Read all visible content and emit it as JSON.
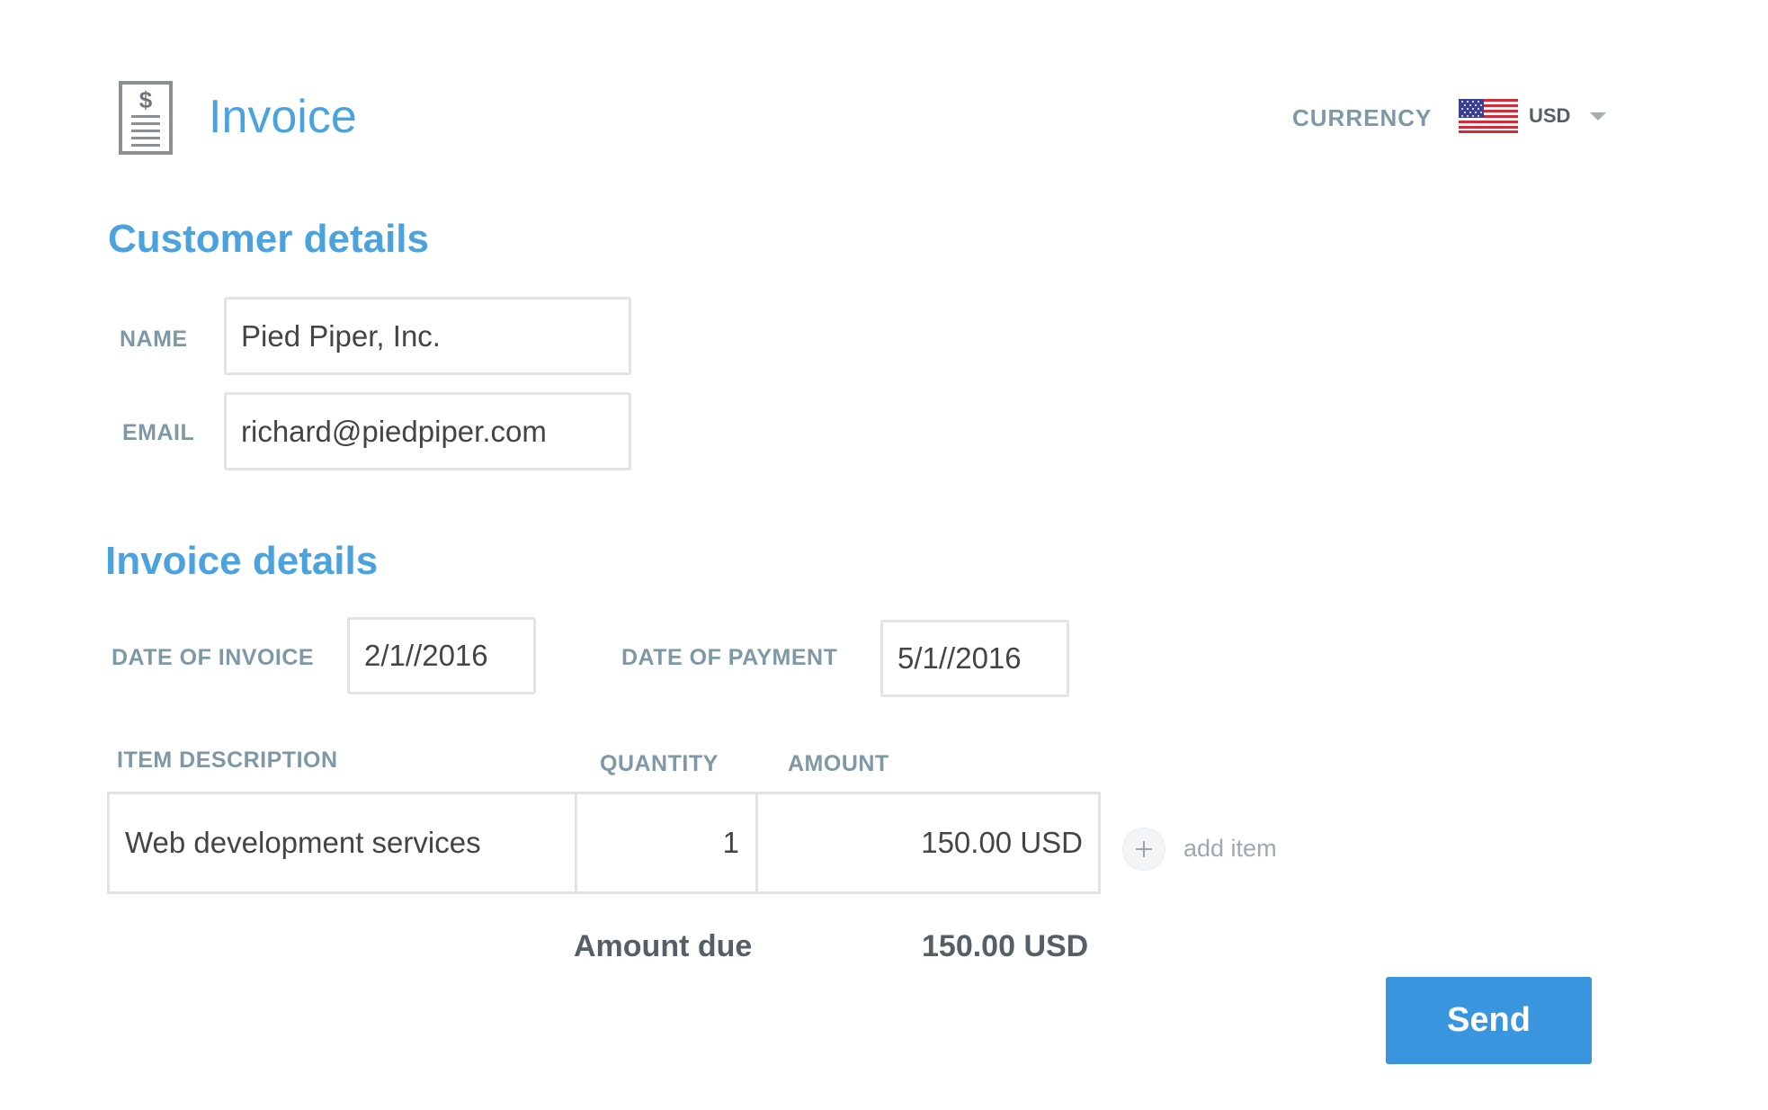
{
  "header": {
    "title": "Invoice",
    "icon": "invoice-dollar-icon",
    "currency_label": "CURRENCY",
    "currency_value": "USD",
    "currency_flag": "us-flag-icon"
  },
  "customer": {
    "heading": "Customer details",
    "name_label": "NAME",
    "name_value": "Pied Piper, Inc.",
    "email_label": "EMAIL",
    "email_value": "richard@piedpiper.com"
  },
  "invoice": {
    "heading": "Invoice details",
    "date_of_invoice_label": "DATE OF INVOICE",
    "date_of_invoice_value": "2/1//2016",
    "date_of_payment_label": "DATE OF PAYMENT",
    "date_of_payment_value": "5/1//2016"
  },
  "items": {
    "columns": {
      "description": "ITEM DESCRIPTION",
      "quantity": "QUANTITY",
      "amount": "AMOUNT"
    },
    "rows": [
      {
        "description": "Web development services",
        "quantity": "1",
        "amount": "150.00 USD"
      }
    ],
    "add_item_label": "add item"
  },
  "totals": {
    "amount_due_label": "Amount due",
    "amount_due_value": "150.00 USD"
  },
  "actions": {
    "send_label": "Send"
  },
  "colors": {
    "accent": "#4aa3df",
    "button": "#3996de",
    "label": "#7e98a6",
    "border": "#e3e3e3"
  }
}
